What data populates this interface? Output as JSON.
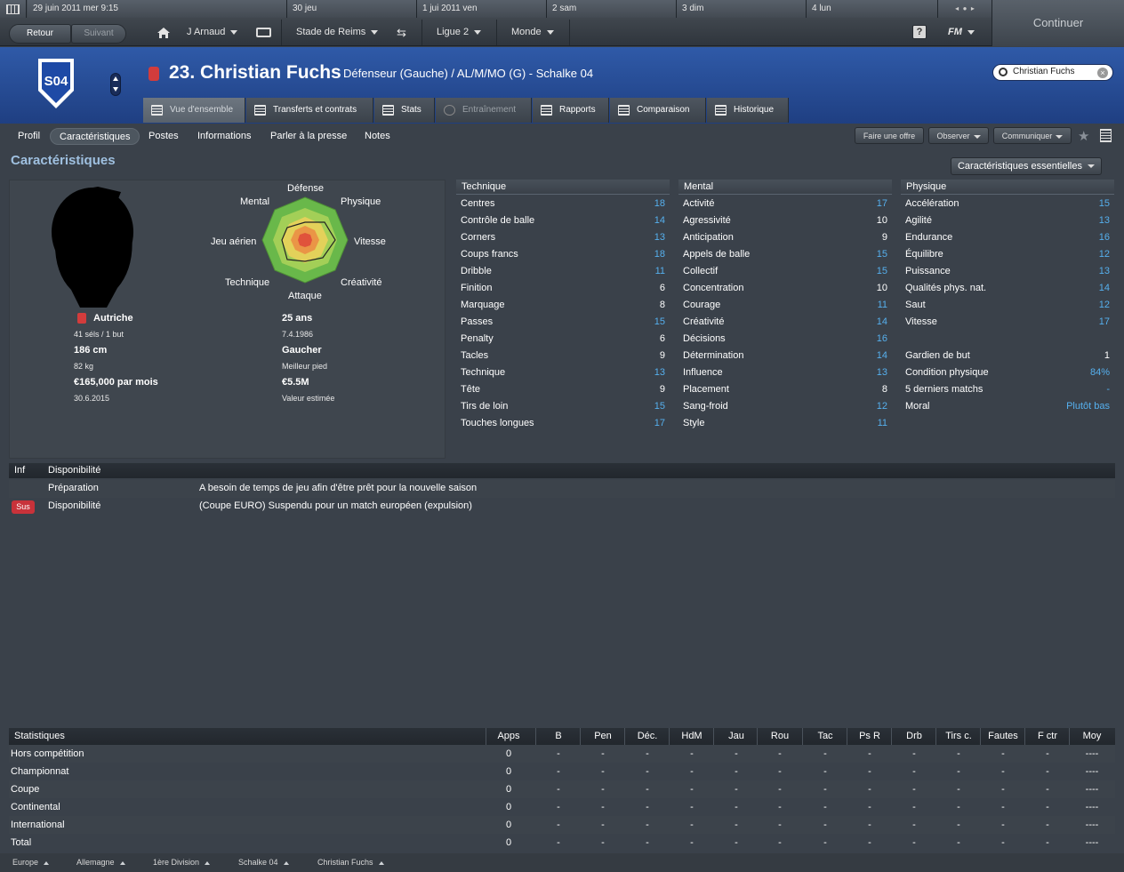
{
  "topbar": {
    "dates": [
      "29 juin 2011  mer  9:15",
      "30  jeu",
      "1 jui 2011  ven",
      "2  sam",
      "3  dim",
      "4  lun"
    ],
    "back": "Retour",
    "forward": "Suivant",
    "manager": "J Arnaud",
    "stadium": "Stade de Reims",
    "league": "Ligue 2",
    "world": "Monde",
    "help": "?",
    "fm": "FM",
    "continue": "Continuer"
  },
  "player": {
    "number_name": "23. Christian Fuchs",
    "position": "Défenseur (Gauche) / AL/M/MO (G) - Schalke 04",
    "club_badge": "S04",
    "search_value": "Christian Fuchs"
  },
  "tabs": [
    "Vue d'ensemble",
    "Transferts et contrats",
    "Stats",
    "Entraînement",
    "Rapports",
    "Comparaison",
    "Historique"
  ],
  "subnav": [
    "Profil",
    "Caractéristiques",
    "Postes",
    "Informations",
    "Parler à la presse",
    "Notes"
  ],
  "actions": {
    "offer": "Faire une offre",
    "watch": "Observer",
    "communicate": "Communiquer"
  },
  "section_title": "Caractéristiques",
  "view_select": "Caractéristiques essentielles",
  "radar_labels": {
    "top": "Défense",
    "top_left": "Mental",
    "top_right": "Physique",
    "left": "Jeu aérien",
    "right": "Vitesse",
    "bottom_left": "Technique",
    "bottom_right": "Créativité",
    "bottom": "Attaque"
  },
  "profile": {
    "nation": "Autriche",
    "caps": "41 séls / 1 but",
    "height": "186 cm",
    "weight": "82 kg",
    "wage": "€165,000 par mois",
    "contract": "30.6.2015",
    "age": "25 ans",
    "dob": "7.4.1986",
    "foot": "Gaucher",
    "foot_label": "Meilleur pied",
    "value": "€5.5M",
    "value_label": "Valeur estimée"
  },
  "technique": {
    "title": "Technique",
    "rows": [
      {
        "name": "Centres",
        "value": "18",
        "hi": true
      },
      {
        "name": "Contrôle de balle",
        "value": "14",
        "hi": true
      },
      {
        "name": "Corners",
        "value": "13",
        "hi": true
      },
      {
        "name": "Coups francs",
        "value": "18",
        "hi": true
      },
      {
        "name": "Dribble",
        "value": "11",
        "hi": true
      },
      {
        "name": "Finition",
        "value": "6",
        "hi": false
      },
      {
        "name": "Marquage",
        "value": "8",
        "hi": false
      },
      {
        "name": "Passes",
        "value": "15",
        "hi": true
      },
      {
        "name": "Penalty",
        "value": "6",
        "hi": false
      },
      {
        "name": "Tacles",
        "value": "9",
        "hi": false
      },
      {
        "name": "Technique",
        "value": "13",
        "hi": true
      },
      {
        "name": "Tête",
        "value": "9",
        "hi": false
      },
      {
        "name": "Tirs de loin",
        "value": "15",
        "hi": true
      },
      {
        "name": "Touches longues",
        "value": "17",
        "hi": true
      }
    ]
  },
  "mental": {
    "title": "Mental",
    "rows": [
      {
        "name": "Activité",
        "value": "17",
        "hi": true
      },
      {
        "name": "Agressivité",
        "value": "10",
        "hi": false
      },
      {
        "name": "Anticipation",
        "value": "9",
        "hi": false
      },
      {
        "name": "Appels de balle",
        "value": "15",
        "hi": true
      },
      {
        "name": "Collectif",
        "value": "15",
        "hi": true
      },
      {
        "name": "Concentration",
        "value": "10",
        "hi": false
      },
      {
        "name": "Courage",
        "value": "11",
        "hi": true
      },
      {
        "name": "Créativité",
        "value": "14",
        "hi": true
      },
      {
        "name": "Décisions",
        "value": "16",
        "hi": true
      },
      {
        "name": "Détermination",
        "value": "14",
        "hi": true
      },
      {
        "name": "Influence",
        "value": "13",
        "hi": true
      },
      {
        "name": "Placement",
        "value": "8",
        "hi": false
      },
      {
        "name": "Sang-froid",
        "value": "12",
        "hi": true
      },
      {
        "name": "Style",
        "value": "11",
        "hi": true
      }
    ]
  },
  "physique": {
    "title": "Physique",
    "rows": [
      {
        "name": "Accélération",
        "value": "15",
        "hi": true
      },
      {
        "name": "Agilité",
        "value": "13",
        "hi": true
      },
      {
        "name": "Endurance",
        "value": "16",
        "hi": true
      },
      {
        "name": "Équilibre",
        "value": "12",
        "hi": true
      },
      {
        "name": "Puissance",
        "value": "13",
        "hi": true
      },
      {
        "name": "Qualités phys. nat.",
        "value": "14",
        "hi": true
      },
      {
        "name": "Saut",
        "value": "12",
        "hi": true
      },
      {
        "name": "Vitesse",
        "value": "17",
        "hi": true
      }
    ]
  },
  "condition": [
    {
      "name": "Gardien de but",
      "value": "1",
      "hi": false
    },
    {
      "name": "Condition physique",
      "value": "84%",
      "hi": true
    },
    {
      "name": "5 derniers matchs",
      "value": "-",
      "hi": true
    },
    {
      "name": "Moral",
      "value": "Plutôt bas",
      "hi": true
    }
  ],
  "availability": {
    "col_inf": "Inf",
    "col_title": "Disponibilité",
    "rows": [
      {
        "badge": "",
        "label": "Préparation",
        "text": "A besoin de temps de jeu afin d'être prêt pour la nouvelle saison"
      },
      {
        "badge": "Sus",
        "label": "Disponibilité",
        "text": "(Coupe EURO) Suspendu pour un match européen (expulsion)"
      }
    ]
  },
  "stats": {
    "title": "Statistiques",
    "columns": [
      "Apps",
      "B",
      "Pen",
      "Déc.",
      "HdM",
      "Jau",
      "Rou",
      "Tac",
      "Ps R",
      "Drb",
      "Tirs c.",
      "Fautes",
      "F ctr",
      "Moy"
    ],
    "rows": [
      {
        "label": "Hors compétition",
        "apps": "0",
        "dash": "-",
        "avg": "----"
      },
      {
        "label": "Championnat",
        "apps": "0",
        "dash": "-",
        "avg": "----"
      },
      {
        "label": "Coupe",
        "apps": "0",
        "dash": "-",
        "avg": "----"
      },
      {
        "label": "Continental",
        "apps": "0",
        "dash": "-",
        "avg": "----"
      },
      {
        "label": "International",
        "apps": "0",
        "dash": "-",
        "avg": "----"
      },
      {
        "label": "Total",
        "apps": "0",
        "dash": "-",
        "avg": "----"
      }
    ]
  },
  "breadcrumb": [
    "Europe",
    "Allemagne",
    "1ère Division",
    "Schalke 04",
    "Christian Fuchs"
  ],
  "colors": {
    "accent_blue": "#56b0ee",
    "header_blue": "#2a4f9c",
    "sus_red": "#c8323a"
  }
}
